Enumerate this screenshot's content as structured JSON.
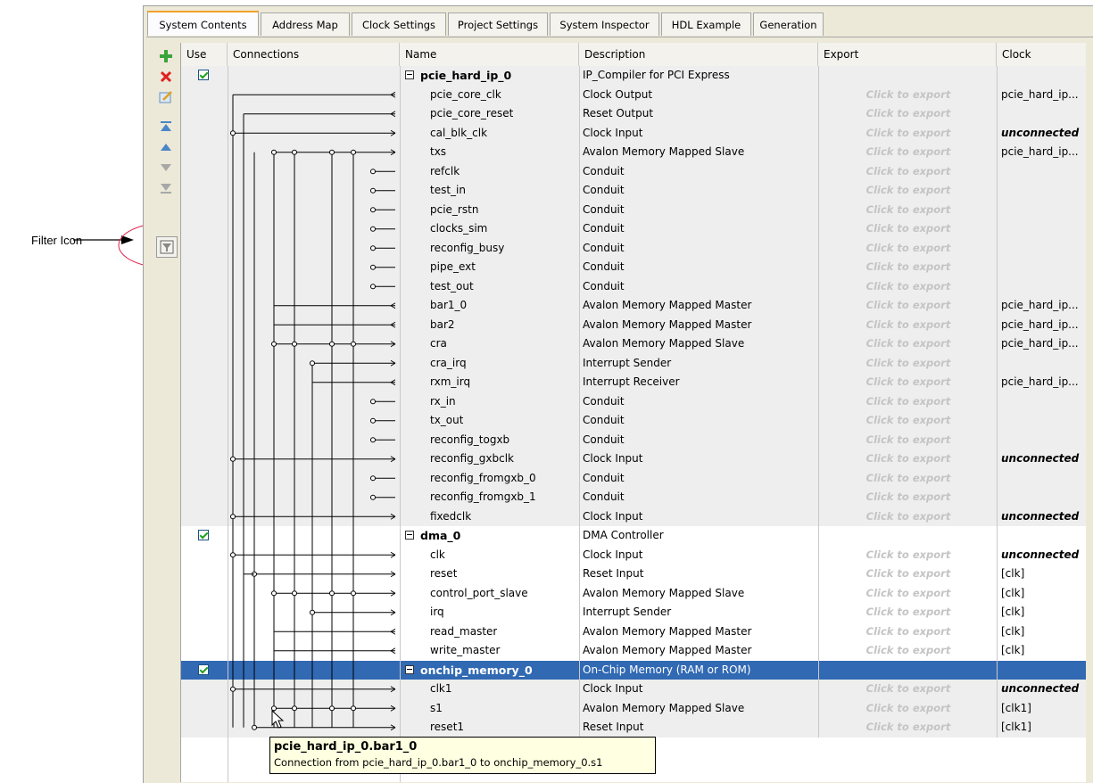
{
  "annotation": {
    "label": "Filter Icon"
  },
  "tabs": [
    "System Contents",
    "Address Map",
    "Clock Settings",
    "Project Settings",
    "System Inspector",
    "HDL Example",
    "Generation"
  ],
  "active_tab": "System Contents",
  "columns": {
    "use": "Use",
    "connections": "Connections",
    "name": "Name",
    "description": "Description",
    "export": "Export",
    "clock": "Clock"
  },
  "toolbar": [
    "add-icon",
    "remove-icon",
    "edit-icon",
    "move-top-icon",
    "move-up-icon",
    "move-down-icon",
    "move-bottom-icon",
    "filter-icon"
  ],
  "export_placeholder": "Click to export",
  "rows": [
    {
      "name": "pcie_hard_ip_0",
      "desc": "IP_Compiler for PCI Express",
      "export": "",
      "clock": "",
      "component": true,
      "use": true
    },
    {
      "name": "pcie_core_clk",
      "desc": "Clock Output",
      "export": "Click to export",
      "clock": "pcie_hard_ip..."
    },
    {
      "name": "pcie_core_reset",
      "desc": "Reset Output",
      "export": "Click to export",
      "clock": ""
    },
    {
      "name": "cal_blk_clk",
      "desc": "Clock Input",
      "export": "Click to export",
      "clock": "unconnected"
    },
    {
      "name": "txs",
      "desc": "Avalon Memory Mapped Slave",
      "export": "Click to export",
      "clock": "pcie_hard_ip..."
    },
    {
      "name": "refclk",
      "desc": "Conduit",
      "export": "Click to export",
      "clock": ""
    },
    {
      "name": "test_in",
      "desc": "Conduit",
      "export": "Click to export",
      "clock": ""
    },
    {
      "name": "pcie_rstn",
      "desc": "Conduit",
      "export": "Click to export",
      "clock": ""
    },
    {
      "name": "clocks_sim",
      "desc": "Conduit",
      "export": "Click to export",
      "clock": ""
    },
    {
      "name": "reconfig_busy",
      "desc": "Conduit",
      "export": "Click to export",
      "clock": ""
    },
    {
      "name": "pipe_ext",
      "desc": "Conduit",
      "export": "Click to export",
      "clock": ""
    },
    {
      "name": "test_out",
      "desc": "Conduit",
      "export": "Click to export",
      "clock": ""
    },
    {
      "name": "bar1_0",
      "desc": "Avalon Memory Mapped Master",
      "export": "Click to export",
      "clock": "pcie_hard_ip..."
    },
    {
      "name": "bar2",
      "desc": "Avalon Memory Mapped Master",
      "export": "Click to export",
      "clock": "pcie_hard_ip..."
    },
    {
      "name": "cra",
      "desc": "Avalon Memory Mapped Slave",
      "export": "Click to export",
      "clock": "pcie_hard_ip..."
    },
    {
      "name": "cra_irq",
      "desc": "Interrupt Sender",
      "export": "Click to export",
      "clock": ""
    },
    {
      "name": "rxm_irq",
      "desc": "Interrupt Receiver",
      "export": "Click to export",
      "clock": "pcie_hard_ip..."
    },
    {
      "name": "rx_in",
      "desc": "Conduit",
      "export": "Click to export",
      "clock": ""
    },
    {
      "name": "tx_out",
      "desc": "Conduit",
      "export": "Click to export",
      "clock": ""
    },
    {
      "name": "reconfig_togxb",
      "desc": "Conduit",
      "export": "Click to export",
      "clock": ""
    },
    {
      "name": "reconfig_gxbclk",
      "desc": "Clock Input",
      "export": "Click to export",
      "clock": "unconnected"
    },
    {
      "name": "reconfig_fromgxb_0",
      "desc": "Conduit",
      "export": "Click to export",
      "clock": ""
    },
    {
      "name": "reconfig_fromgxb_1",
      "desc": "Conduit",
      "export": "Click to export",
      "clock": ""
    },
    {
      "name": "fixedclk",
      "desc": "Clock Input",
      "export": "Click to export",
      "clock": "unconnected"
    },
    {
      "name": "dma_0",
      "desc": "DMA Controller",
      "export": "",
      "clock": "",
      "component": true,
      "use": true
    },
    {
      "name": "clk",
      "desc": "Clock Input",
      "export": "Click to export",
      "clock": "unconnected"
    },
    {
      "name": "reset",
      "desc": "Reset Input",
      "export": "Click to export",
      "clock": "[clk]"
    },
    {
      "name": "control_port_slave",
      "desc": "Avalon Memory Mapped Slave",
      "export": "Click to export",
      "clock": "[clk]"
    },
    {
      "name": "irq",
      "desc": "Interrupt Sender",
      "export": "Click to export",
      "clock": "[clk]"
    },
    {
      "name": "read_master",
      "desc": "Avalon Memory Mapped Master",
      "export": "Click to export",
      "clock": "[clk]"
    },
    {
      "name": "write_master",
      "desc": "Avalon Memory Mapped Master",
      "export": "Click to export",
      "clock": "[clk]"
    },
    {
      "name": "onchip_memory_0",
      "desc": "On-Chip Memory (RAM or ROM)",
      "export": "",
      "clock": "",
      "component": true,
      "use": true,
      "selected": true
    },
    {
      "name": "clk1",
      "desc": "Clock Input",
      "export": "Click to export",
      "clock": "unconnected"
    },
    {
      "name": "s1",
      "desc": "Avalon Memory Mapped Slave",
      "export": "Click to export",
      "clock": "[clk1]"
    },
    {
      "name": "reset1",
      "desc": "Reset Input",
      "export": "Click to export",
      "clock": "[clk1]"
    }
  ],
  "tooltip": {
    "title": "pcie_hard_ip_0.bar1_0",
    "text": "Connection from pcie_hard_ip_0.bar1_0 to onchip_memory_0.s1"
  }
}
